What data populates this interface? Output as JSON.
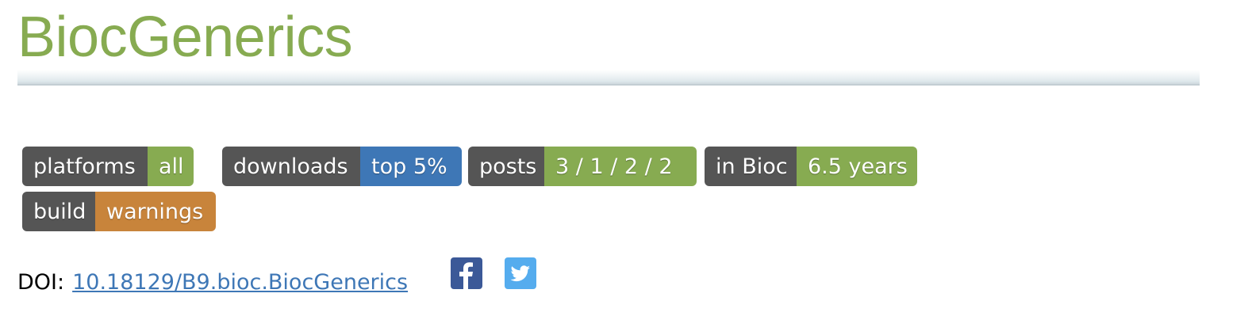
{
  "page": {
    "title": "BiocGenerics"
  },
  "badges": {
    "platforms": {
      "label": "platforms",
      "value": "all",
      "value_color": "#87AB51"
    },
    "downloads": {
      "label": "downloads",
      "value": "top 5%",
      "value_color": "#3E77B6"
    },
    "posts": {
      "label": "posts",
      "value": "3 / 1 / 2 / 2",
      "value_color": "#87AB51"
    },
    "in_bioc": {
      "label": "in Bioc",
      "value": "6.5 years",
      "value_color": "#87AB51"
    },
    "build": {
      "label": "build",
      "value": "warnings",
      "value_color": "#C8843B"
    }
  },
  "doi": {
    "label": "DOI:",
    "link_text": "10.18129/B9.bioc.BiocGenerics"
  },
  "social": {
    "facebook_icon": "facebook-icon",
    "facebook_color": "#3B5998",
    "twitter_icon": "twitter-icon",
    "twitter_color": "#55ACEE"
  }
}
